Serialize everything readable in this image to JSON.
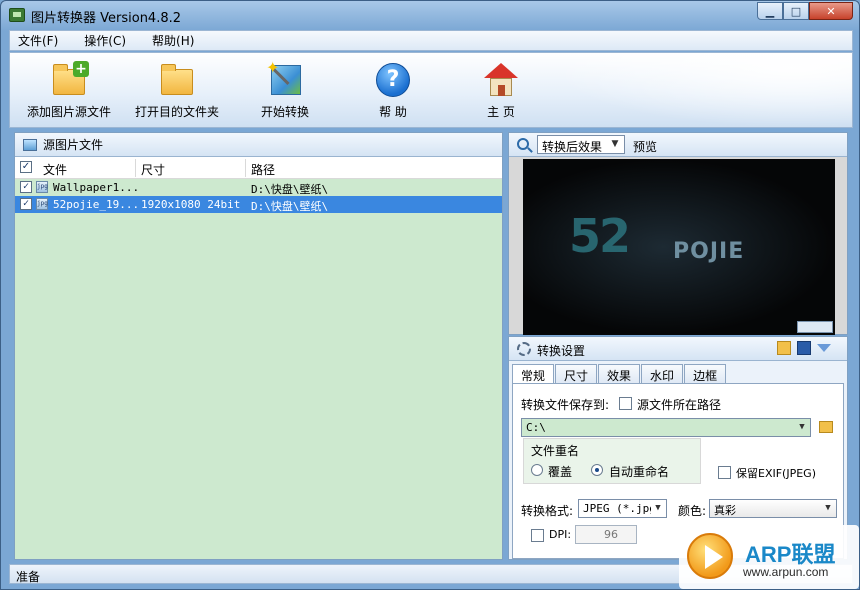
{
  "window": {
    "title": "图片转换器 Version4.8.2",
    "min_glyph": "▁",
    "max_glyph": "□",
    "close_glyph": "✕"
  },
  "menu": [
    "文件(F)",
    "操作(C)",
    "帮助(H)"
  ],
  "toolbar": {
    "add_source": "添加图片源文件",
    "open_dest": "打开目的文件夹",
    "start": "开始转换",
    "help": "帮 助",
    "home": "主 页"
  },
  "source_panel": {
    "title": "源图片文件",
    "columns": {
      "file": "文件",
      "size": "尺寸",
      "path": "路径"
    },
    "rows": [
      {
        "checked": true,
        "name": "Wallpaper1...",
        "size": "",
        "path": "D:\\快盘\\壁纸\\",
        "selected": false
      },
      {
        "checked": true,
        "name": "52pojie_19...",
        "size": "1920x1080   24bit",
        "path": "D:\\快盘\\壁纸\\",
        "selected": true
      }
    ]
  },
  "preview_panel": {
    "mode": "转换后效果",
    "label": "预览",
    "image_text_big": "52",
    "image_text_small": "POJIE"
  },
  "settings": {
    "title": "转换设置",
    "tabs": [
      "常规",
      "尺寸",
      "效果",
      "水印",
      "边框"
    ],
    "active_tab": 0,
    "save_to_label": "转换文件保存到:",
    "same_as_source_label": "源文件所在路径",
    "save_path": "C:\\",
    "rename_group_title": "文件重名",
    "overwrite_label": "覆盖",
    "auto_rename_label": "自动重命名",
    "auto_rename_selected": true,
    "keep_exif_label": "保留EXIF(JPEG)",
    "format_label": "转换格式:",
    "format_value": "JPEG (*.jpg",
    "color_label": "颜色:",
    "color_value": "真彩",
    "dpi_label": "DPI:",
    "dpi_value": "96"
  },
  "status": {
    "text": "准备"
  },
  "watermark": {
    "brand": "ARP联盟",
    "url": "www.arpun.com"
  },
  "colors": {
    "list_bg": "#cde9cf",
    "selection": "#3a87e0",
    "frame": "#7aa7d3"
  }
}
